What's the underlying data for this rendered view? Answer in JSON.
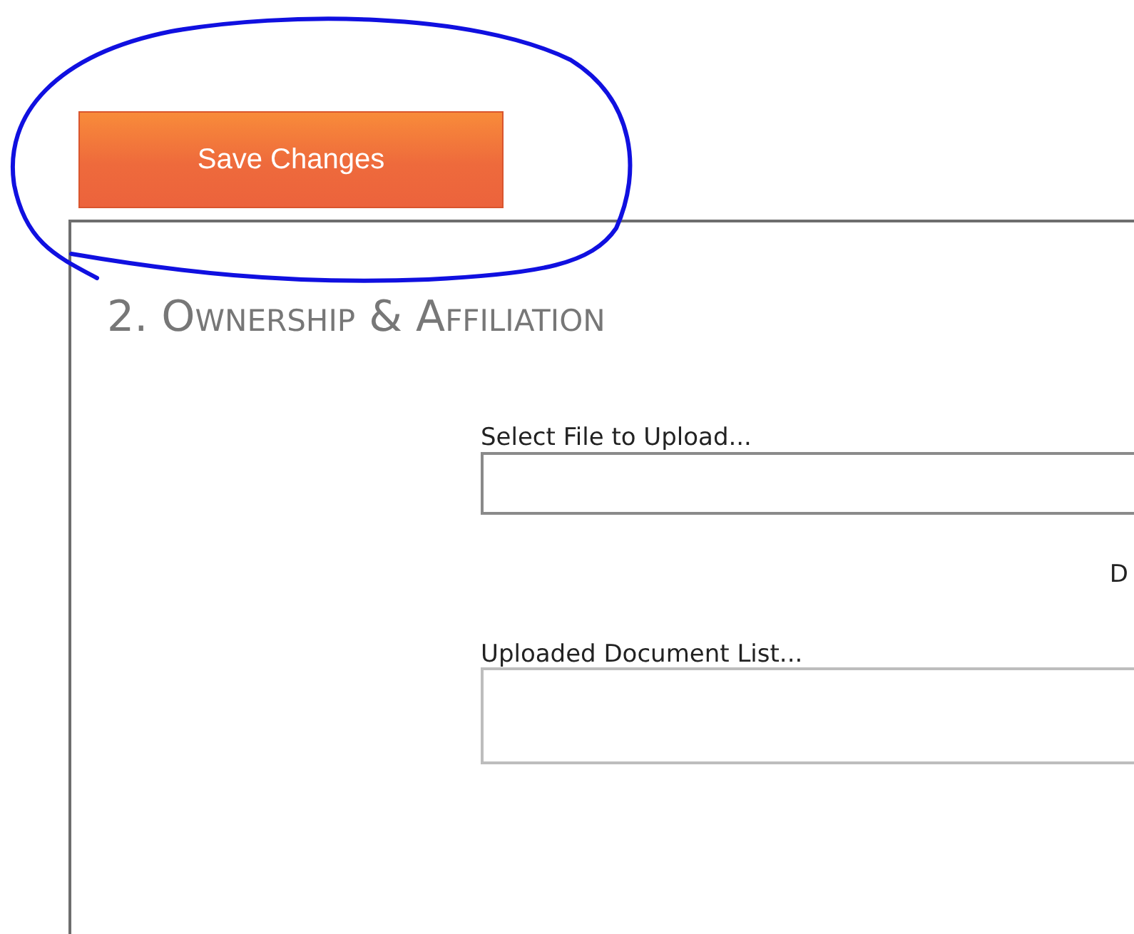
{
  "save_button": {
    "label": "Save Changes"
  },
  "section": {
    "title": "2. Ownership & Affiliation",
    "fields": [
      {
        "kind": "file",
        "label": "Select File to Upload..."
      },
      {
        "kind": "list",
        "label": "Uploaded Document List..."
      }
    ],
    "cut_text": "D"
  }
}
